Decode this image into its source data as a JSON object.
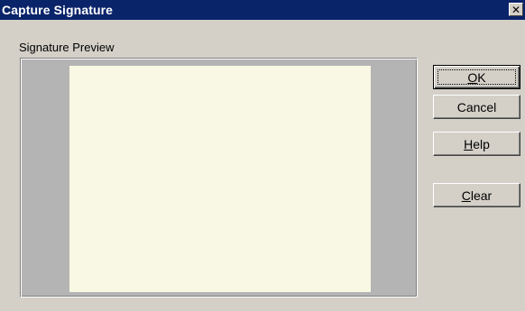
{
  "window": {
    "title": "Capture Signature",
    "close_glyph": "✕"
  },
  "preview": {
    "group_label": "Signature Preview",
    "canvas_color": "#f8f8e4",
    "frame_color": "#b4b4b4"
  },
  "buttons": {
    "ok": {
      "mnemonic": "O",
      "rest": "K"
    },
    "cancel": {
      "label": "Cancel"
    },
    "help": {
      "mnemonic": "H",
      "rest": "elp"
    },
    "clear": {
      "mnemonic": "C",
      "rest": "lear"
    }
  },
  "colors": {
    "titlebar": "#0a246a",
    "dialog_face": "#d4d0c8"
  }
}
